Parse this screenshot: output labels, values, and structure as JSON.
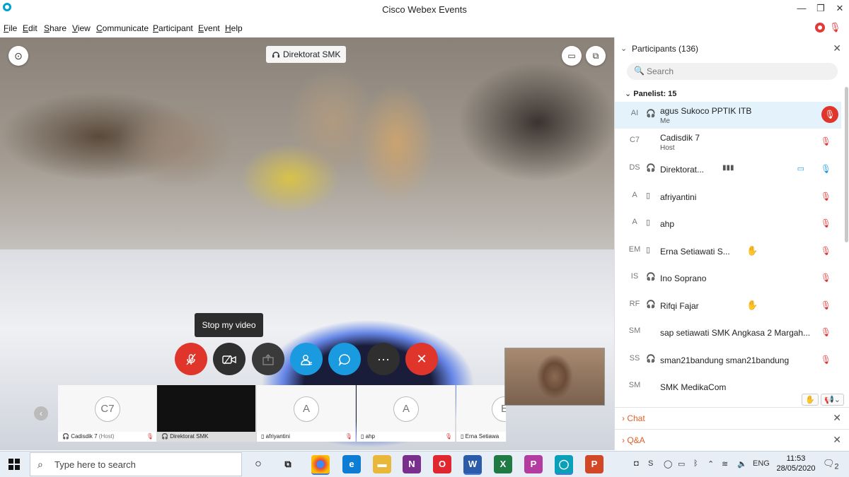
{
  "window": {
    "title": "Cisco Webex Events",
    "min": "—",
    "max": "❐",
    "close": "✕"
  },
  "menu": [
    {
      "first": "F",
      "rest": "ile"
    },
    {
      "first": "E",
      "rest": "dit"
    },
    {
      "first": "S",
      "rest": "hare"
    },
    {
      "first": "V",
      "rest": "iew"
    },
    {
      "first": "C",
      "rest": "ommunicate"
    },
    {
      "first": "P",
      "rest": "articipant"
    },
    {
      "first": "E",
      "rest": "vent"
    },
    {
      "first": "H",
      "rest": "elp"
    }
  ],
  "stage": {
    "speaker": "Direktorat SMK",
    "tooltip": "Stop my video"
  },
  "thumbnails": [
    {
      "initials": "C7",
      "label": "Cadisdik 7",
      "role": "(Host)"
    },
    {
      "initials": "",
      "label": "Direktorat SMK",
      "role": ""
    },
    {
      "initials": "A",
      "label": "afriyantini",
      "role": ""
    },
    {
      "initials": "A",
      "label": "ahp",
      "role": ""
    },
    {
      "initials": "E",
      "label": "Erna Setiawa",
      "role": ""
    }
  ],
  "participants_panel": {
    "title": "Participants (136)",
    "search_placeholder": "Search",
    "group_label": "Panelist: 15",
    "rows": [
      {
        "initials": "AI",
        "name": "agus Sukoco PPTIK ITB",
        "role": "Me"
      },
      {
        "initials": "C7",
        "name": "Cadisdik 7",
        "role": "Host"
      },
      {
        "initials": "DS",
        "name": "Direktorat...",
        "role": ""
      },
      {
        "initials": "A",
        "name": "afriyantini",
        "role": ""
      },
      {
        "initials": "A",
        "name": "ahp",
        "role": ""
      },
      {
        "initials": "EM",
        "name": "Erna Setiawati S...",
        "role": ""
      },
      {
        "initials": "IS",
        "name": "Ino Soprano",
        "role": ""
      },
      {
        "initials": "RF",
        "name": "Rifqi Fajar",
        "role": ""
      },
      {
        "initials": "SM",
        "name": "sap setiawati SMK Angkasa 2 Margah...",
        "role": ""
      },
      {
        "initials": "SS",
        "name": "sman21bandung sman21bandung",
        "role": ""
      },
      {
        "initials": "SM",
        "name": "SMK MedikaCom",
        "role": ""
      }
    ]
  },
  "sections": {
    "chat": "Chat",
    "qa": "Q&A"
  },
  "taskbar": {
    "search_text": "Type here to search",
    "language": "ENG",
    "time": "11:53",
    "date": "28/05/2020",
    "notifications": "2"
  },
  "colors": {
    "accent": "#00a0d1",
    "danger": "#e0352b",
    "section": "#e0602b"
  }
}
